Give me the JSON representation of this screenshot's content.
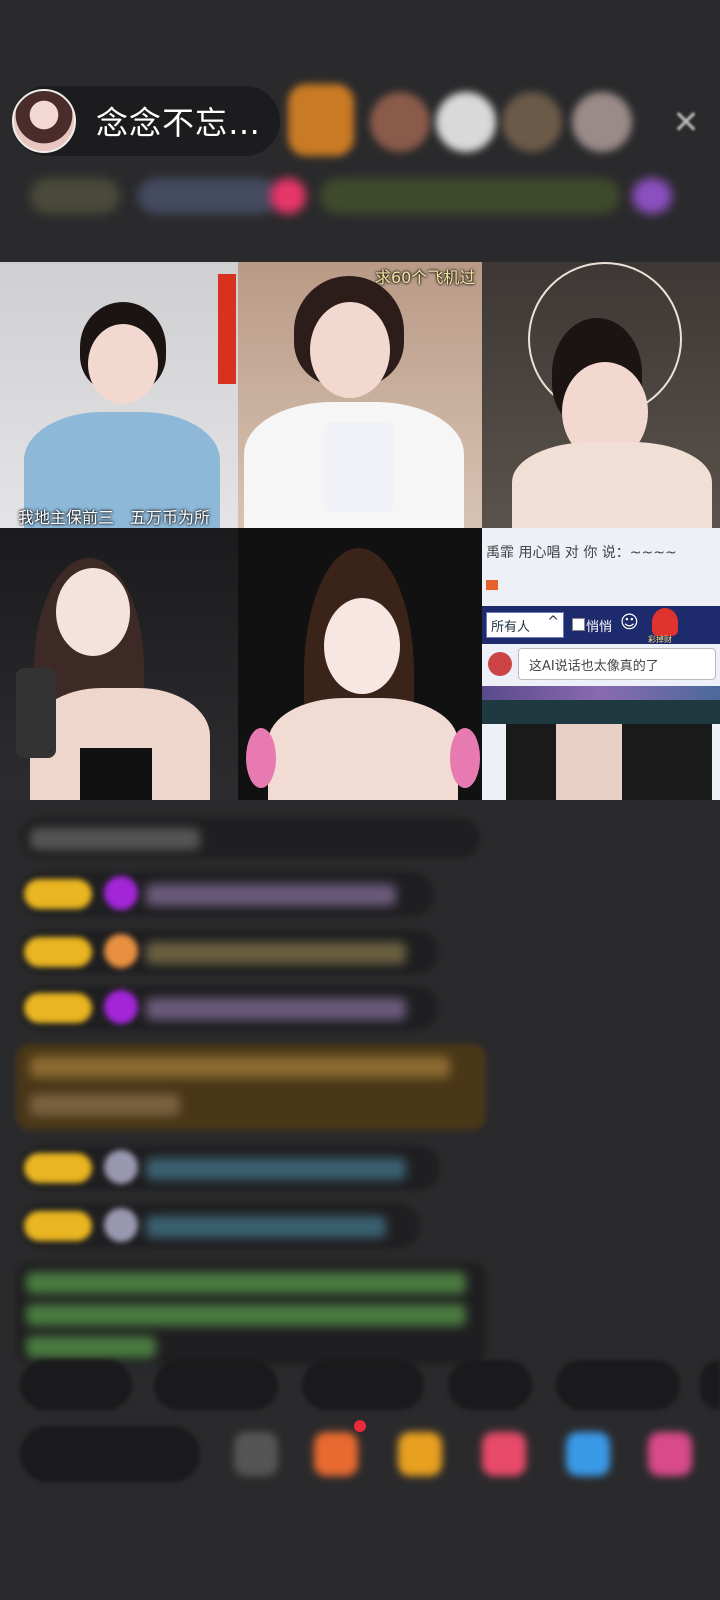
{
  "header": {
    "host_name": "念念不忘…",
    "close_glyph": "✕"
  },
  "video_grid": {
    "cell_1_caption": "我地主保前三　五万币为所",
    "cell_2_caption": "求60个飞机过"
  },
  "chat_overlay": {
    "message_line": "禹霏 用心唱 对 你 说：~~~~",
    "audience_select": "所有人",
    "whisper_label": "悄悄",
    "input_text": "这AI说话也太像真的了",
    "gift_label": "彩掉财"
  },
  "colors": {
    "background": "#2a2a2c",
    "badge_yellow": "#e9b520",
    "accent_purple": "#9b30d9"
  }
}
